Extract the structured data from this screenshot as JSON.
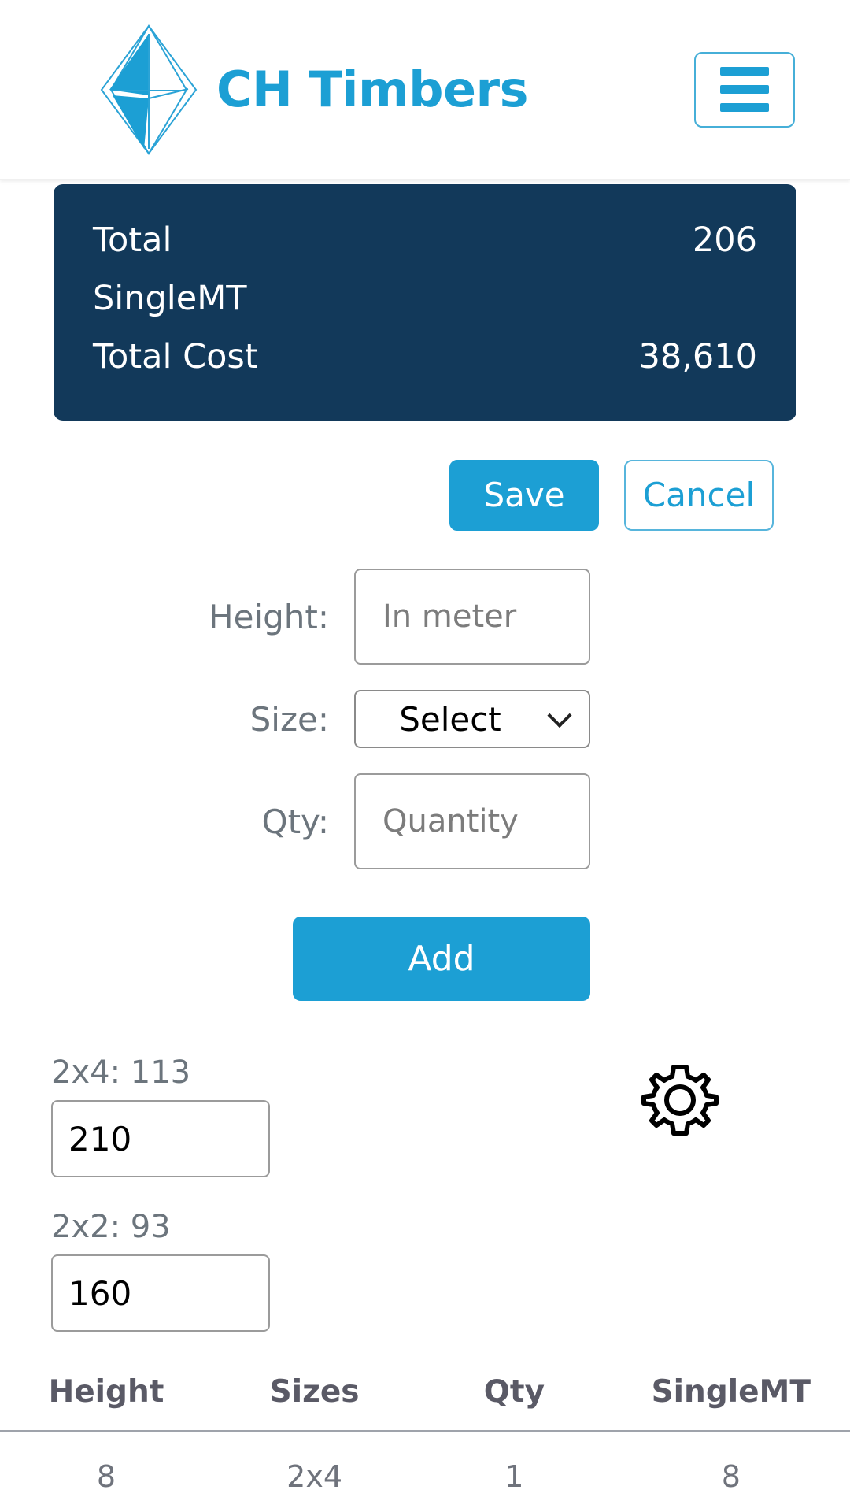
{
  "header": {
    "brand_name": "CH Timbers",
    "logo_icon": "octahedron-diamond-icon",
    "menu_icon": "hamburger-menu-icon"
  },
  "summary": {
    "rows": [
      {
        "label": "Total",
        "value": "206"
      },
      {
        "label": "SingleMT",
        "value": ""
      },
      {
        "label": "Total Cost",
        "value": "38,610"
      }
    ]
  },
  "actions": {
    "save_label": "Save",
    "cancel_label": "Cancel"
  },
  "form": {
    "height": {
      "label": "Height:",
      "placeholder": "In meter",
      "value": ""
    },
    "size": {
      "label": "Size:",
      "selected": "Select",
      "chevron_icon": "chevron-down-icon"
    },
    "qty": {
      "label": "Qty:",
      "placeholder": "Quantity",
      "value": ""
    },
    "add_label": "Add"
  },
  "prices": {
    "gear_icon": "gear-settings-icon",
    "items": [
      {
        "label": "2x4: 113",
        "value": "210"
      },
      {
        "label": "2x2: 93",
        "value": "160"
      }
    ]
  },
  "table": {
    "columns": [
      "Height",
      "Sizes",
      "Qty",
      "SingleMT"
    ],
    "rows": [
      [
        "8",
        "2x4",
        "1",
        "8"
      ]
    ]
  },
  "colors": {
    "brand_blue": "#1C9FD4",
    "dark_navy": "#12395A",
    "label_gray": "#6c757d",
    "border_gray": "#9b9b9b"
  }
}
